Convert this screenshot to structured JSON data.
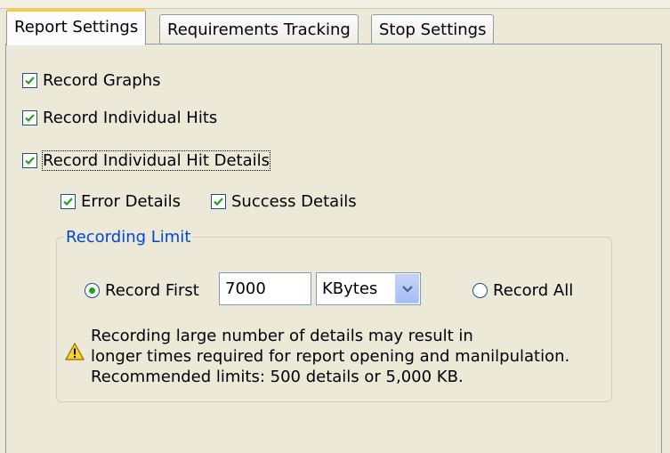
{
  "tabs": [
    {
      "label": "Report Settings",
      "active": true
    },
    {
      "label": "Requirements Tracking",
      "active": false
    },
    {
      "label": "Stop Settings",
      "active": false
    }
  ],
  "options": {
    "record_graphs": {
      "label": "Record Graphs",
      "checked": true
    },
    "record_individual_hits": {
      "label": "Record Individual Hits",
      "checked": true
    },
    "record_individual_hit_details": {
      "label": "Record Individual Hit Details",
      "checked": true
    },
    "error_details": {
      "label": "Error Details",
      "checked": true
    },
    "success_details": {
      "label": "Success Details",
      "checked": true
    }
  },
  "recording_limit": {
    "legend": "Recording Limit",
    "record_first_label": "Record First",
    "record_first_selected": true,
    "limit_value": "7000",
    "unit": "KBytes",
    "record_all_label": "Record All",
    "record_all_selected": false,
    "warning_lines": [
      "Recording large number of details may result in",
      "longer times required for report opening and manilpulation.",
      "Recommended limits: 500 details or 5,000 KB."
    ]
  },
  "icons": {
    "check": "checkmark-icon",
    "warning": "warning-icon",
    "dropdown": "chevron-down-icon"
  },
  "colors": {
    "background": "#ECE9D8",
    "active_tab_accent": "#FFC83C",
    "check": "#21A121",
    "legend_text": "#0046D5"
  }
}
